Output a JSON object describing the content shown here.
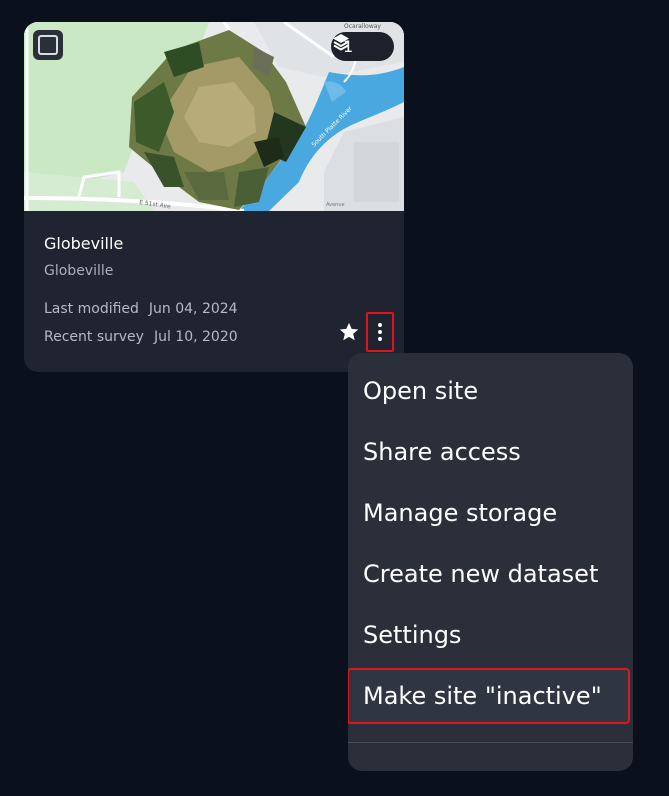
{
  "card": {
    "layer_count": "1",
    "title": "Globeville",
    "subtitle": "Globeville",
    "last_modified_label": "Last modified",
    "last_modified_value": "Jun 04, 2024",
    "recent_survey_label": "Recent survey",
    "recent_survey_value": "Jul 10, 2020",
    "map_labels": {
      "river": "South Platte River",
      "street": "E 51st Ave",
      "top_street": "Ocaralloway",
      "avenue": "Avenue"
    }
  },
  "menu": {
    "items": [
      {
        "label": "Open site"
      },
      {
        "label": "Share access"
      },
      {
        "label": "Manage storage"
      },
      {
        "label": "Create new dataset"
      },
      {
        "label": "Settings"
      },
      {
        "label": "Make site \"inactive\""
      }
    ]
  },
  "colors": {
    "background": "#0b111c",
    "card": "#1f2430",
    "menu": "#2a2f3a",
    "highlight_border": "#e0141b"
  }
}
